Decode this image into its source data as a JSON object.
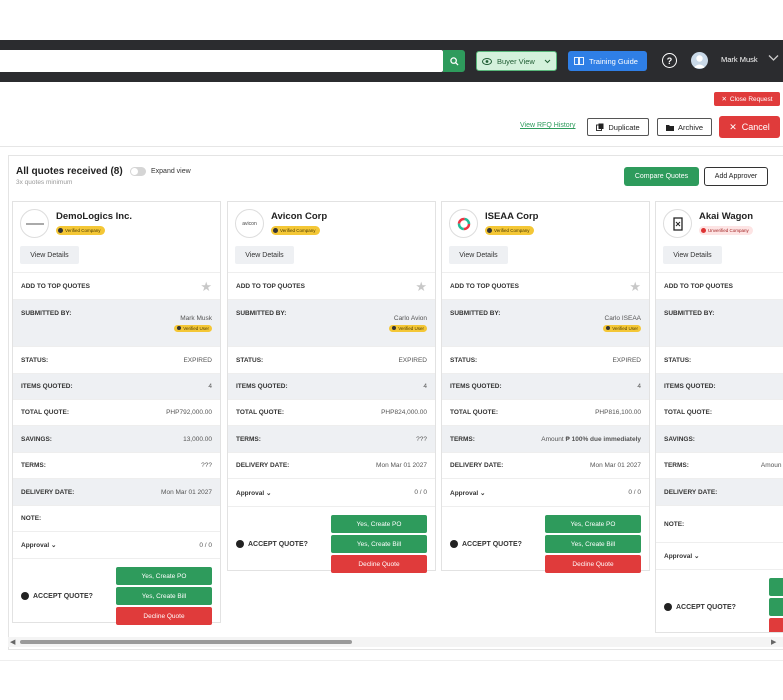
{
  "topbar": {
    "buyer_view_label": "Buyer View",
    "training_label": "Training Guide",
    "user_name": "Mark Musk"
  },
  "actions": {
    "close_request": "Close Request",
    "view_rfq_history": "View RFQ History",
    "duplicate": "Duplicate",
    "archive": "Archive",
    "cancel": "Cancel"
  },
  "panel": {
    "title": "All quotes received (8)",
    "subtitle": "3x quotes minimum",
    "expand_label": "Expand view",
    "compare_label": "Compare Quotes",
    "add_approver_label": "Add Approver"
  },
  "colors": {
    "green": "#2e9b5c",
    "red": "#e03b3b",
    "blue": "#2f7fe6",
    "topbar": "#2b2c2f"
  },
  "common": {
    "view_details": "View Details",
    "add_top": "ADD TO TOP QUOTES",
    "submitted_by": "SUBMITTED BY:",
    "status": "STATUS:",
    "items_quoted": "ITEMS QUOTED:",
    "total_quote": "TOTAL QUOTE:",
    "savings": "SAVINGS:",
    "terms": "TERMS:",
    "delivery_date": "DELIVERY DATE:",
    "note": "NOTE:",
    "approval": "Approval",
    "accept_quote": "ACCEPT QUOTE?",
    "create_po": "Yes, Create PO",
    "create_bill": "Yes, Create Bill",
    "decline": "Decline Quote",
    "verified_company": "Verified Company",
    "unverified_company": "Unverified Company",
    "verified_user": "Verified User"
  },
  "quotes": [
    {
      "vendor": "DemoLogics Inc.",
      "submitter": "Mark Musk",
      "status": "EXPIRED",
      "items": "4",
      "total": "PHP792,000.00",
      "savings": "13,000.00",
      "terms": "???",
      "delivery": "Mon Mar 01 2027",
      "approval_count": "0 / 0"
    },
    {
      "vendor": "Avicon Corp",
      "logo_text": "avicon",
      "submitter": "Carlo Avion",
      "status": "EXPIRED",
      "items": "4",
      "total": "PHP824,000.00",
      "terms": "???",
      "delivery": "Mon Mar 01 2027",
      "approval_count": "0 / 0"
    },
    {
      "vendor": "ISEAA Corp",
      "submitter": "Carlo ISEAA",
      "status": "EXPIRED",
      "items": "4",
      "total": "PHP816,100.00",
      "terms_prefix": "Amount ",
      "terms_bold": "₱ 100% due immediately",
      "delivery": "Mon Mar 01 2027",
      "approval_count": "0 / 0"
    },
    {
      "vendor": "Akai Wagon",
      "terms_partial": "Amoun"
    }
  ]
}
